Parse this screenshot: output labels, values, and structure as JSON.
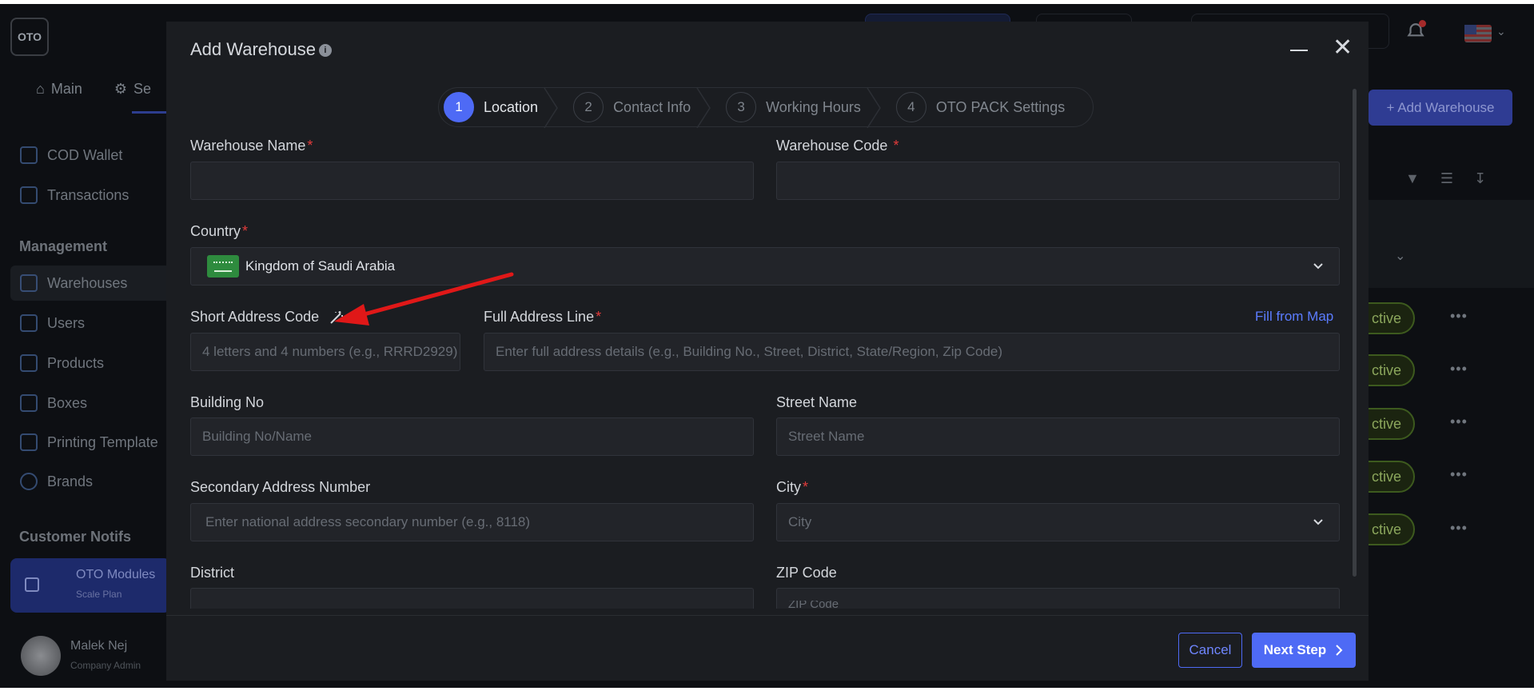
{
  "app": {
    "logo_text": "OTO",
    "nav_tabs": [
      {
        "label": "Main",
        "icon": "home-icon"
      },
      {
        "label": "Se",
        "icon": "gear-icon"
      }
    ],
    "sidebar": {
      "items_top": [
        {
          "label": "COD Wallet",
          "icon": "wallet-icon"
        },
        {
          "label": "Transactions",
          "icon": "receipt-icon"
        }
      ],
      "management_heading": "Management",
      "items_management": [
        {
          "label": "Warehouses",
          "icon": "warehouse-icon"
        },
        {
          "label": "Users",
          "icon": "users-icon"
        },
        {
          "label": "Products",
          "icon": "tag-icon"
        },
        {
          "label": "Boxes",
          "icon": "box-icon"
        },
        {
          "label": "Printing Template",
          "icon": "printer-icon"
        },
        {
          "label": "Brands",
          "icon": "brand-icon"
        }
      ],
      "customer_heading": "Customer Notifs",
      "modules_title": "OTO Modules",
      "modules_plan": "Scale Plan",
      "user_name": "Malek Nej",
      "user_role": "Company Admin"
    },
    "add_warehouse_button": "+ Add Warehouse",
    "status_label": "ctive",
    "row_menu": "•••"
  },
  "modal": {
    "title": "Add Warehouse",
    "info_icon": "i",
    "close_glyph": "✕",
    "steps": [
      {
        "num": "1",
        "label": "Location",
        "active": true
      },
      {
        "num": "2",
        "label": "Contact Info",
        "active": false
      },
      {
        "num": "3",
        "label": "Working Hours",
        "active": false
      },
      {
        "num": "4",
        "label": "OTO PACK Settings",
        "active": false
      }
    ],
    "fields": {
      "warehouse_name": {
        "label": "Warehouse Name",
        "required": "*",
        "value": ""
      },
      "warehouse_code": {
        "label": "Warehouse Code",
        "required": "*",
        "value": ""
      },
      "country": {
        "label": "Country",
        "required": "*",
        "value": "Kingdom of Saudi Arabia"
      },
      "short_address": {
        "label": "Short Address Code",
        "placeholder": "4 letters and 4 numbers (e.g., RRRD2929)"
      },
      "full_address": {
        "label": "Full Address Line",
        "required": "*",
        "placeholder": "Enter full address details (e.g., Building No., Street, District, State/Region, Zip Code)",
        "fill_from_map": "Fill from Map"
      },
      "building_no": {
        "label": "Building No",
        "placeholder": "Building No/Name"
      },
      "street_name": {
        "label": "Street Name",
        "placeholder": "Street Name"
      },
      "secondary_number": {
        "label": "Secondary Address Number",
        "placeholder": "Enter national address secondary number (e.g., 8118)"
      },
      "city": {
        "label": "City",
        "required": "*",
        "placeholder": "City"
      },
      "district": {
        "label": "District",
        "placeholder": ""
      },
      "zip_code": {
        "label": "ZIP Code",
        "placeholder": "ZIP Code"
      }
    },
    "cancel_label": "Cancel",
    "next_label": "Next Step"
  },
  "colors": {
    "accent": "#4e6af5",
    "required": "#e23b3b",
    "annotation_arrow": "#e01818",
    "modal_bg": "#1b1d21"
  }
}
